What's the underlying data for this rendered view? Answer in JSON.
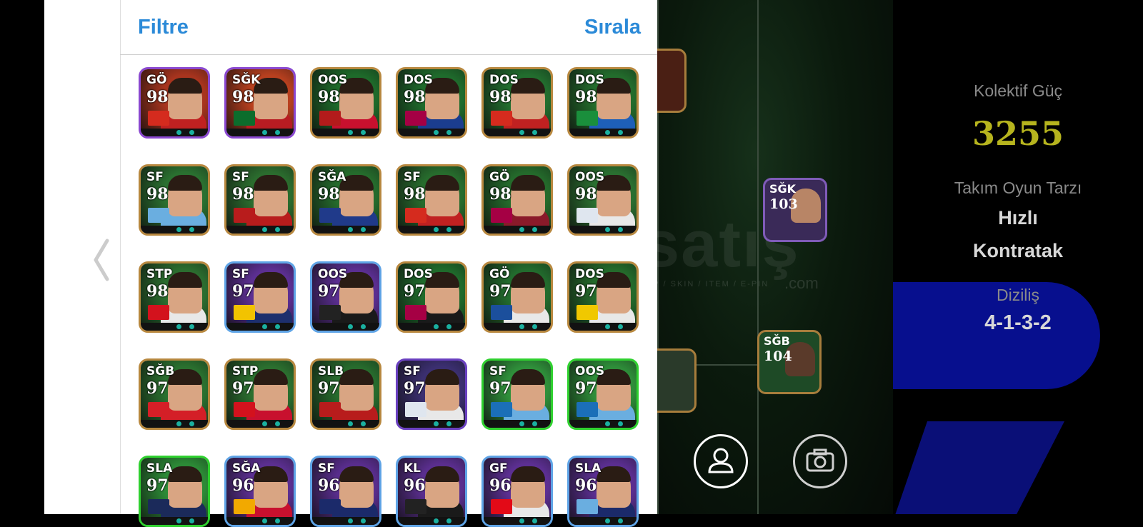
{
  "header": {
    "filter_label": "Filtre",
    "sort_label": "Sırala"
  },
  "right_panel": {
    "collective_power_label": "Kolektif Güç",
    "collective_power_value": "3255",
    "team_style_label": "Takım Oyun Tarzı",
    "team_style_line1": "Hızlı",
    "team_style_line2": "Kontratak",
    "formation_label": "Diziliş",
    "formation_value": "4-1-3-2"
  },
  "watermark": {
    "main": "satış",
    "sub": "AP / SKIN / ITEM / E-PIN",
    "com": ".com"
  },
  "field_cards": [
    {
      "pos": "SĞK",
      "rating": "103"
    },
    {
      "pos": "SĞB",
      "rating": "104"
    }
  ],
  "cards": [
    {
      "pos": "GÖ",
      "rating": "98",
      "frame": "purple",
      "bg": "#a8341e",
      "jersey": "#c02121",
      "badge": "#d52b1e"
    },
    {
      "pos": "SĞK",
      "rating": "98",
      "frame": "purple",
      "bg": "#b8401f",
      "jersey": "#b81c22",
      "badge": "#0c6d2c"
    },
    {
      "pos": "OOS",
      "rating": "98",
      "frame": "gold",
      "bg": "#1e6a2a",
      "jersey": "#c8102e",
      "badge": "#b31b1b"
    },
    {
      "pos": "DOS",
      "rating": "98",
      "frame": "gold",
      "bg": "#1f6b2c",
      "jersey": "#1b3d8f",
      "badge": "#a50044"
    },
    {
      "pos": "DOS",
      "rating": "98",
      "frame": "gold",
      "bg": "#226d2e",
      "jersey": "#c02121",
      "badge": "#d52b1e"
    },
    {
      "pos": "DOS",
      "rating": "98",
      "frame": "gold",
      "bg": "#236c2c",
      "jersey": "#1e5fb8",
      "badge": "#1a8f3c"
    },
    {
      "pos": "SF",
      "rating": "98",
      "frame": "gold",
      "bg": "#2a7030",
      "jersey": "#6aaee0",
      "badge": "#6aaee0"
    },
    {
      "pos": "SF",
      "rating": "98",
      "frame": "gold",
      "bg": "#2b6c2e",
      "jersey": "#b81c1c",
      "badge": "#b81c1c"
    },
    {
      "pos": "SĞA",
      "rating": "98",
      "frame": "gold",
      "bg": "#256b2c",
      "jersey": "#203a8a",
      "badge": "#203a8a"
    },
    {
      "pos": "SF",
      "rating": "98",
      "frame": "gold",
      "bg": "#276c2d",
      "jersey": "#c02121",
      "badge": "#d52b1e"
    },
    {
      "pos": "GÖ",
      "rating": "98",
      "frame": "gold",
      "bg": "#246a2b",
      "jersey": "#8a1a2a",
      "badge": "#a50044"
    },
    {
      "pos": "OOS",
      "rating": "98",
      "frame": "gold",
      "bg": "#2a6f30",
      "jersey": "#e8e8e8",
      "badge": "#dfe6ef"
    },
    {
      "pos": "STP",
      "rating": "98",
      "frame": "gold",
      "bg": "#2b6d2f",
      "jersey": "#e8e8e8",
      "badge": "#d3121d"
    },
    {
      "pos": "SF",
      "rating": "97",
      "frame": "blue",
      "bg": "#5c2f92",
      "jersey": "#1d2f6d",
      "badge": "#f2c300"
    },
    {
      "pos": "OOS",
      "rating": "97",
      "frame": "blue",
      "bg": "#5a2e90",
      "jersey": "#1a1a1a",
      "badge": "#222222"
    },
    {
      "pos": "DOS",
      "rating": "97",
      "frame": "gold",
      "bg": "#1f6a2b",
      "jersey": "#1a1a1a",
      "badge": "#a50044"
    },
    {
      "pos": "GÖ",
      "rating": "97",
      "frame": "gold",
      "bg": "#226b2d",
      "jersey": "#e8e8e8",
      "badge": "#1b4f9c"
    },
    {
      "pos": "DOS",
      "rating": "97",
      "frame": "gold",
      "bg": "#246a2b",
      "jersey": "#e8e8e8",
      "badge": "#f0c800"
    },
    {
      "pos": "SĞB",
      "rating": "97",
      "frame": "gold",
      "bg": "#2a702f",
      "jersey": "#d41f27",
      "badge": "#d41f27"
    },
    {
      "pos": "STP",
      "rating": "97",
      "frame": "gold",
      "bg": "#2b6f2f",
      "jersey": "#c8102e",
      "badge": "#d3121d"
    },
    {
      "pos": "SLB",
      "rating": "97",
      "frame": "gold",
      "bg": "#276b2d",
      "jersey": "#b81c1c",
      "badge": "#b81c1c"
    },
    {
      "pos": "SF",
      "rating": "97",
      "frame": "violet",
      "bg": "#3b2f70",
      "jersey": "#e8e8e8",
      "badge": "#dfe6ef"
    },
    {
      "pos": "SF",
      "rating": "97",
      "frame": "lgreen",
      "bg": "#2f8f3a",
      "jersey": "#6aaee0",
      "badge": "#1b6fb8"
    },
    {
      "pos": "OOS",
      "rating": "97",
      "frame": "lgreen",
      "bg": "#2e8d39",
      "jersey": "#6aaee0",
      "badge": "#1b6fb8"
    },
    {
      "pos": "SLA",
      "rating": "97",
      "frame": "lgreen",
      "bg": "#2c8a36",
      "jersey": "#1b2a5a",
      "badge": "#1b2a5a"
    },
    {
      "pos": "SĞA",
      "rating": "96",
      "frame": "blue",
      "bg": "#5b2f90",
      "jersey": "#c8102e",
      "badge": "#f2a900"
    },
    {
      "pos": "SF",
      "rating": "96",
      "frame": "blue",
      "bg": "#582d8c",
      "jersey": "#1b2a6a",
      "badge": "#1b2a6a"
    },
    {
      "pos": "KL",
      "rating": "96",
      "frame": "blue",
      "bg": "#5a2e8e",
      "jersey": "#1a1a1a",
      "badge": "#222222"
    },
    {
      "pos": "GF",
      "rating": "96",
      "frame": "blue",
      "bg": "#5c2f92",
      "jersey": "#e8e8e8",
      "badge": "#e30a17"
    },
    {
      "pos": "SLA",
      "rating": "96",
      "frame": "blue",
      "bg": "#5a2e90",
      "jersey": "#1b2a6a",
      "badge": "#6aaee0"
    }
  ]
}
